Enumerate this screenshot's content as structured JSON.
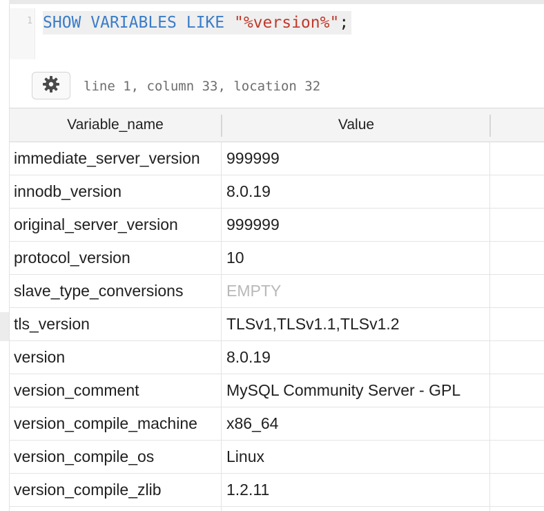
{
  "editor": {
    "line_number": "1",
    "query": {
      "keyword1": "SHOW",
      "keyword2": "VARIABLES",
      "keyword3": "LIKE",
      "string": "\"%version%\"",
      "terminator": ";"
    },
    "settings_icon": "gear-icon",
    "status": "line 1, column 33, location 32"
  },
  "results": {
    "columns": [
      "Variable_name",
      "Value"
    ],
    "rows": [
      {
        "name": "immediate_server_version",
        "value": "999999"
      },
      {
        "name": "innodb_version",
        "value": "8.0.19"
      },
      {
        "name": "original_server_version",
        "value": "999999"
      },
      {
        "name": "protocol_version",
        "value": "10"
      },
      {
        "name": "slave_type_conversions",
        "value": "EMPTY",
        "empty": true
      },
      {
        "name": "tls_version",
        "value": "TLSv1,TLSv1.1,TLSv1.2"
      },
      {
        "name": "version",
        "value": "8.0.19"
      },
      {
        "name": "version_comment",
        "value": "MySQL Community Server - GPL"
      },
      {
        "name": "version_compile_machine",
        "value": "x86_64"
      },
      {
        "name": "version_compile_os",
        "value": "Linux"
      },
      {
        "name": "version_compile_zlib",
        "value": "1.2.11"
      }
    ]
  },
  "colors": {
    "keyword": "#3a7dc9",
    "string": "#c0392b",
    "empty_value": "#b8b8b8"
  }
}
